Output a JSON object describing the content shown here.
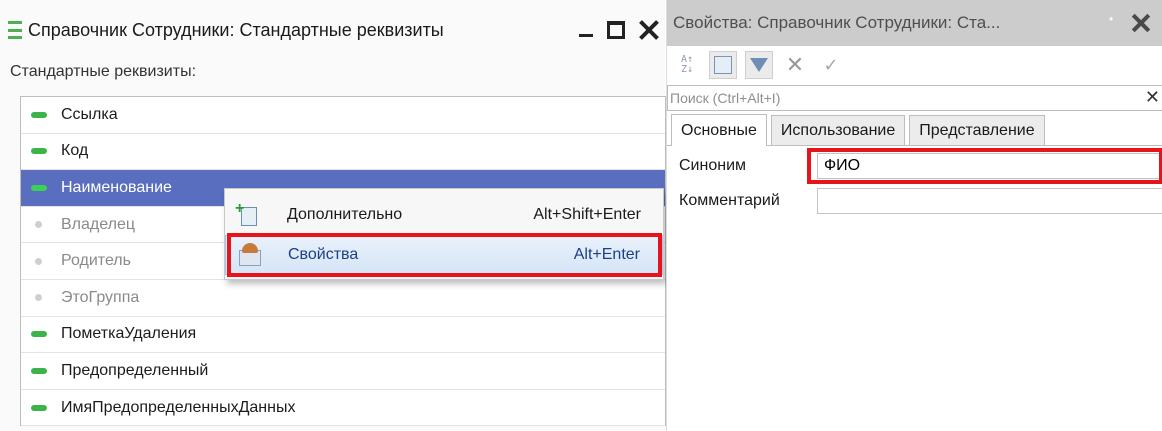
{
  "left_window": {
    "title": "Справочник Сотрудники: Стандартные реквизиты",
    "label": "Стандартные реквизиты:",
    "attributes": [
      {
        "label": "Ссылка"
      },
      {
        "label": "Код"
      },
      {
        "label": "Наименование"
      },
      {
        "label": "Владелец"
      },
      {
        "label": "Родитель"
      },
      {
        "label": "ЭтоГруппа"
      },
      {
        "label": "ПометкаУдаления"
      },
      {
        "label": "Предопределенный"
      },
      {
        "label": "ИмяПредопределенныхДанных"
      }
    ],
    "selected_attribute": "Наименование"
  },
  "context_menu": {
    "items": [
      {
        "label": "Дополнительно",
        "shortcut": "Alt+Shift+Enter",
        "icon": "add-document-icon"
      },
      {
        "label": "Свойства",
        "shortcut": "Alt+Enter",
        "icon": "properties-icon"
      }
    ],
    "highlighted": "Свойства"
  },
  "right_window": {
    "title": "Свойства: Справочник Сотрудники: Ста...",
    "search_placeholder": "Поиск (Ctrl+Alt+I)",
    "tabs": [
      {
        "label": "Основные"
      },
      {
        "label": "Использование"
      },
      {
        "label": "Представление"
      }
    ],
    "active_tab": "Основные",
    "properties": {
      "synonym_label": "Синоним",
      "synonym_value": "ФИО",
      "comment_label": "Комментарий",
      "comment_value": ""
    }
  },
  "colors": {
    "selection": "#5a6ebf",
    "highlight_border": "#e8141b",
    "attribute_marker": "#3bb54a"
  }
}
